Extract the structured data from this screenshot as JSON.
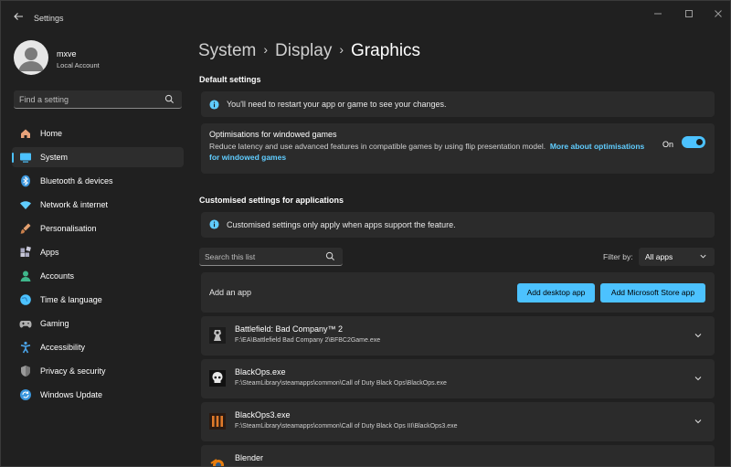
{
  "window": {
    "title": "Settings",
    "back_icon": "back-arrow-icon",
    "controls": [
      "minimize-icon",
      "maximize-icon",
      "close-icon"
    ]
  },
  "profile": {
    "name": "mxve",
    "account_type": "Local Account"
  },
  "sidebar": {
    "search_placeholder": "Find a setting",
    "items": [
      {
        "label": "Home",
        "icon": "home-icon",
        "active": false,
        "color": "#e8a27a"
      },
      {
        "label": "System",
        "icon": "system-icon",
        "active": true,
        "color": "#4cc2ff"
      },
      {
        "label": "Bluetooth & devices",
        "icon": "bluetooth-icon",
        "active": false,
        "color": "#3a96dd"
      },
      {
        "label": "Network & internet",
        "icon": "wifi-icon",
        "active": false,
        "color": "#60cdff"
      },
      {
        "label": "Personalisation",
        "icon": "brush-icon",
        "active": false,
        "color": "#e3a06f"
      },
      {
        "label": "Apps",
        "icon": "apps-icon",
        "active": false,
        "color": "#c8c8d8"
      },
      {
        "label": "Accounts",
        "icon": "accounts-icon",
        "active": false,
        "color": "#3fb68b"
      },
      {
        "label": "Time & language",
        "icon": "globe-icon",
        "active": false,
        "color": "#4cc2ff"
      },
      {
        "label": "Gaming",
        "icon": "gaming-icon",
        "active": false,
        "color": "#b0b0b0"
      },
      {
        "label": "Accessibility",
        "icon": "accessibility-icon",
        "active": false,
        "color": "#4aa3e8"
      },
      {
        "label": "Privacy & security",
        "icon": "shield-icon",
        "active": false,
        "color": "#9a9a9a"
      },
      {
        "label": "Windows Update",
        "icon": "update-icon",
        "active": false,
        "color": "#3a96dd"
      }
    ]
  },
  "breadcrumb": {
    "items": [
      "System",
      "Display"
    ],
    "current": "Graphics"
  },
  "default_settings": {
    "title": "Default settings",
    "info": "You'll need to restart your app or game to see your changes.",
    "optimisations": {
      "title": "Optimisations for windowed games",
      "description": "Reduce latency and use advanced features in compatible games by using flip presentation model.",
      "link": "More about optimisations for windowed games",
      "toggle_label": "On",
      "toggle_on": true
    }
  },
  "custom_settings": {
    "title": "Customised settings for applications",
    "info": "Customised settings only apply when apps support the feature.",
    "search_placeholder": "Search this list",
    "filter_label": "Filter by:",
    "filter_value": "All apps",
    "add_app_label": "Add an app",
    "add_desktop_button": "Add desktop app",
    "add_store_button": "Add Microsoft Store app"
  },
  "apps": [
    {
      "name": "Battlefield: Bad Company™ 2",
      "path": "F:\\EA\\Battlefield Bad Company 2\\BFBC2Game.exe",
      "icon": "battlefield-icon"
    },
    {
      "name": "BlackOps.exe",
      "path": "F:\\SteamLibrary\\steamapps\\common\\Call of Duty Black Ops\\BlackOps.exe",
      "icon": "blackops-icon"
    },
    {
      "name": "BlackOps3.exe",
      "path": "F:\\SteamLibrary\\steamapps\\common\\Call of Duty Black Ops III\\BlackOps3.exe",
      "icon": "blackops3-icon"
    },
    {
      "name": "Blender",
      "path": "",
      "icon": "blender-icon"
    }
  ],
  "colors": {
    "accent": "#4cc2ff",
    "background": "#202020",
    "card": "#2b2b2b",
    "link": "#60cdff"
  }
}
